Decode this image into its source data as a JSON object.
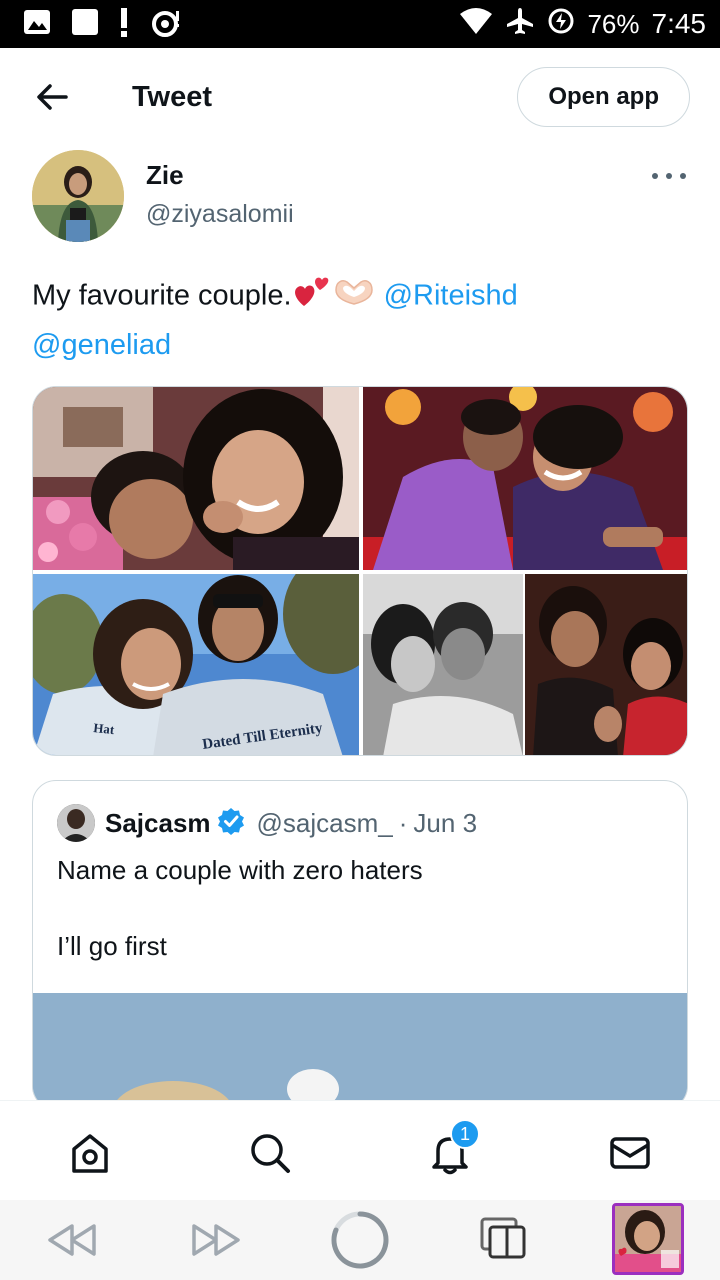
{
  "status_bar": {
    "battery": "76%",
    "time": "7:45",
    "icons": [
      "image-icon",
      "square-icon",
      "alert-icon",
      "cast-icon",
      "wifi-icon",
      "airplane-icon",
      "battery-saver-icon"
    ]
  },
  "header": {
    "title": "Tweet",
    "open_app_label": "Open app",
    "back_icon": "arrow-left-icon"
  },
  "tweet": {
    "author_name": "Zie",
    "author_handle": "@ziyasalomii",
    "text": "My favourite couple.",
    "emojis": [
      "two-hearts",
      "heart-hands"
    ],
    "mentions": [
      "@Riteishd",
      "@geneliad"
    ],
    "photo_caption_1": "Dated Till Eternity",
    "photo_caption_2": "Hat"
  },
  "quoted": {
    "name": "Sajcasm",
    "handle": "@sajcasm_",
    "separator": "·",
    "date": "Jun 3",
    "line1": "Name a couple with zero haters",
    "line2": "I’ll go first"
  },
  "tabbar": {
    "items": [
      "home-icon",
      "search-icon",
      "notifications-icon",
      "messages-icon"
    ],
    "notification_badge": "1"
  },
  "navbar": {
    "items": [
      "rewind-icon",
      "fast-forward-icon",
      "loading-icon",
      "tabs-icon",
      "tab-thumbnail"
    ]
  },
  "colors": {
    "accent": "#1d9bf0",
    "text": "#0f1419",
    "secondary": "#536471",
    "border": "#cfd9de",
    "tab_thumb_border": "#9b2fbf"
  }
}
